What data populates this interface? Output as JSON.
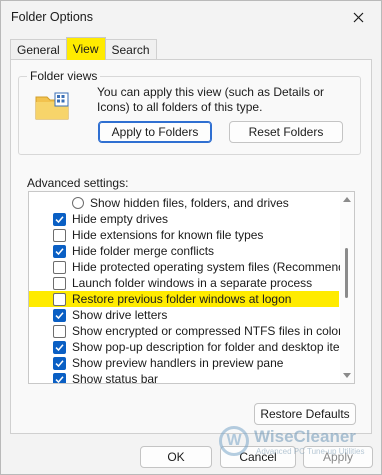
{
  "window": {
    "title": "Folder Options"
  },
  "tabs": [
    {
      "label": "General",
      "active": false
    },
    {
      "label": "View",
      "active": true
    },
    {
      "label": "Search",
      "active": false
    }
  ],
  "folder_views": {
    "legend": "Folder views",
    "description": "You can apply this view (such as Details or Icons) to all folders of this type.",
    "apply_button": "Apply to Folders",
    "reset_button": "Reset Folders"
  },
  "advanced": {
    "label": "Advanced settings:",
    "items": [
      {
        "type": "radio",
        "label": "Show hidden files, folders, and drives",
        "checked": false
      },
      {
        "type": "checkbox",
        "label": "Hide empty drives",
        "checked": true
      },
      {
        "type": "checkbox",
        "label": "Hide extensions for known file types",
        "checked": false
      },
      {
        "type": "checkbox",
        "label": "Hide folder merge conflicts",
        "checked": true
      },
      {
        "type": "checkbox",
        "label": "Hide protected operating system files (Recommended)",
        "checked": false
      },
      {
        "type": "checkbox",
        "label": "Launch folder windows in a separate process",
        "checked": false
      },
      {
        "type": "checkbox",
        "label": "Restore previous folder windows at logon",
        "checked": false,
        "highlighted": true
      },
      {
        "type": "checkbox",
        "label": "Show drive letters",
        "checked": true
      },
      {
        "type": "checkbox",
        "label": "Show encrypted or compressed NTFS files in color",
        "checked": false
      },
      {
        "type": "checkbox",
        "label": "Show pop-up description for folder and desktop items",
        "checked": true
      },
      {
        "type": "checkbox",
        "label": "Show preview handlers in preview pane",
        "checked": true
      },
      {
        "type": "checkbox",
        "label": "Show status bar",
        "checked": true
      }
    ],
    "restore_defaults": "Restore Defaults"
  },
  "footer": {
    "ok": "OK",
    "cancel": "Cancel",
    "apply": "Apply"
  },
  "watermark": {
    "logo_letter": "W",
    "name": "WiseCleaner",
    "tagline": "Advanced PC Tune-up Utilities"
  },
  "colors": {
    "highlight": "#ffeb00",
    "checkbox_checked": "#0a5fc4",
    "primary_border": "#2f6fd1"
  }
}
